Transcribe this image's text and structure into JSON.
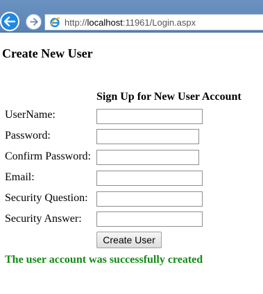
{
  "browser": {
    "url_prefix": "http://",
    "url_host": "localhost",
    "url_rest": ":11961/Login.aspx",
    "back_icon": "back-arrow-icon",
    "forward_icon": "forward-arrow-icon",
    "page_icon": "internet-explorer-icon"
  },
  "page": {
    "title": "Create New User",
    "section_title": "Sign Up for New User Account"
  },
  "form": {
    "fields": [
      {
        "label": "UserName:",
        "value": ""
      },
      {
        "label": "Password:",
        "value": ""
      },
      {
        "label": "Confirm Password:",
        "value": ""
      },
      {
        "label": "Email:",
        "value": ""
      },
      {
        "label": "Security Question:",
        "value": ""
      },
      {
        "label": "Security Answer:",
        "value": ""
      }
    ],
    "submit_label": "Create User"
  },
  "status": {
    "message": "The user account was successfully created",
    "color": "#138a13"
  },
  "colors": {
    "chrome": "#5a82b4",
    "back_button": "#1e88e5"
  }
}
